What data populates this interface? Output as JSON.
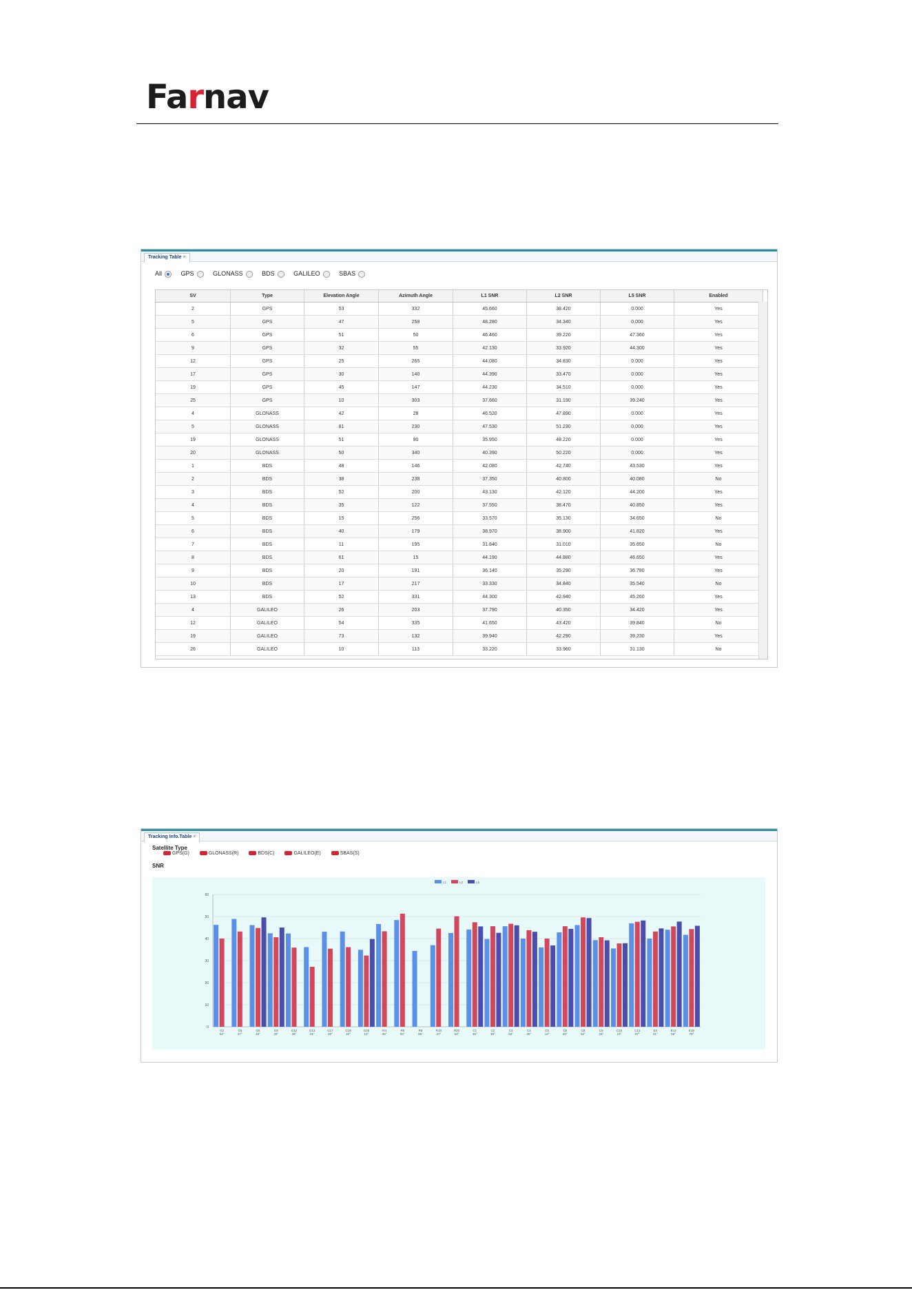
{
  "brand": "Farnav",
  "tracking_table": {
    "tab_label": "Tracking Table",
    "tab_close": "×",
    "filters": [
      {
        "label": "All",
        "checked": true
      },
      {
        "label": "GPS",
        "checked": false
      },
      {
        "label": "GLONASS",
        "checked": false
      },
      {
        "label": "BDS",
        "checked": false
      },
      {
        "label": "GALILEO",
        "checked": false
      },
      {
        "label": "SBAS",
        "checked": false
      }
    ],
    "columns": [
      "SV",
      "Type",
      "Elevation Angle",
      "Azimuth Angle",
      "L1 SNR",
      "L2 SNR",
      "L5 SNR",
      "Enabled"
    ],
    "rows": [
      [
        "2",
        "GPS",
        "53",
        "332",
        "45.660",
        "38.420",
        "0.000",
        "Yes"
      ],
      [
        "5",
        "GPS",
        "47",
        "258",
        "48.280",
        "34.340",
        "0.000",
        "Yes"
      ],
      [
        "6",
        "GPS",
        "51",
        "50",
        "46.460",
        "39.220",
        "47.360",
        "Yes"
      ],
      [
        "9",
        "GPS",
        "32",
        "55",
        "42.130",
        "33.920",
        "44.300",
        "Yes"
      ],
      [
        "12",
        "GPS",
        "25",
        "265",
        "44.080",
        "34.830",
        "0.000",
        "Yes"
      ],
      [
        "17",
        "GPS",
        "30",
        "140",
        "44.390",
        "33.470",
        "0.000",
        "Yes"
      ],
      [
        "19",
        "GPS",
        "45",
        "147",
        "44.230",
        "34.510",
        "0.000",
        "Yes"
      ],
      [
        "25",
        "GPS",
        "10",
        "303",
        "37.660",
        "31.190",
        "39.240",
        "Yes"
      ],
      [
        "4",
        "GLONASS",
        "42",
        "28",
        "46.520",
        "47.890",
        "0.000",
        "Yes"
      ],
      [
        "5",
        "GLONASS",
        "81",
        "230",
        "47.530",
        "51.230",
        "0.000",
        "Yes"
      ],
      [
        "19",
        "GLONASS",
        "51",
        "90",
        "35.950",
        "48.220",
        "0.000",
        "Yes"
      ],
      [
        "20",
        "GLONASS",
        "50",
        "340",
        "40.390",
        "50.220",
        "0.000",
        "Yes"
      ],
      [
        "1",
        "BDS",
        "48",
        "146",
        "42.080",
        "42.740",
        "43.530",
        "Yes"
      ],
      [
        "2",
        "BDS",
        "38",
        "238",
        "37.350",
        "40.800",
        "40.080",
        "No"
      ],
      [
        "3",
        "BDS",
        "52",
        "200",
        "43.130",
        "42.120",
        "44.200",
        "Yes"
      ],
      [
        "4",
        "BDS",
        "35",
        "122",
        "37.550",
        "38.470",
        "40.850",
        "Yes"
      ],
      [
        "5",
        "BDS",
        "15",
        "256",
        "33.570",
        "35.130",
        "34.650",
        "No"
      ],
      [
        "6",
        "BDS",
        "40",
        "179",
        "38.970",
        "38.900",
        "41.820",
        "Yes"
      ],
      [
        "7",
        "BDS",
        "11",
        "195",
        "31.840",
        "31.010",
        "35.650",
        "No"
      ],
      [
        "8",
        "BDS",
        "61",
        "15",
        "44.190",
        "44.880",
        "46.650",
        "Yes"
      ],
      [
        "9",
        "BDS",
        "20",
        "191",
        "36.140",
        "35.290",
        "36.780",
        "Yes"
      ],
      [
        "10",
        "BDS",
        "17",
        "217",
        "33.330",
        "34.840",
        "35.540",
        "No"
      ],
      [
        "13",
        "BDS",
        "52",
        "331",
        "44.300",
        "42.940",
        "45.260",
        "Yes"
      ],
      [
        "4",
        "GALILEO",
        "26",
        "203",
        "37.790",
        "40.350",
        "34.420",
        "Yes"
      ],
      [
        "12",
        "GALILEO",
        "54",
        "335",
        "41.650",
        "43.420",
        "39.840",
        "No"
      ],
      [
        "19",
        "GALILEO",
        "73",
        "132",
        "39.940",
        "42.290",
        "39.230",
        "Yes"
      ],
      [
        "26",
        "GALILEO",
        "10",
        "113",
        "33.220",
        "33.960",
        "31.130",
        "No"
      ]
    ]
  },
  "tracking_info": {
    "tab_label": "Tracking Info.Table",
    "tab_close": "×",
    "satellite_type_label": "Satellite Type",
    "legend": [
      "GPS(G)",
      "GLONASS(R)",
      "BDS(C)",
      "GALILEO(E)",
      "SBAS(S)"
    ],
    "legend_color": "#d7232f",
    "snr_label": "SNR"
  },
  "chart_data": {
    "type": "bar",
    "title": "",
    "xlabel": "",
    "ylabel": "",
    "ylim": [
      0,
      60
    ],
    "yticks": [
      "0",
      "10",
      "20",
      "30",
      "40",
      "50",
      "60"
    ],
    "grid": true,
    "legend_position": "top-center",
    "categories": [
      [
        "G2",
        "53°"
      ],
      [
        "G5",
        "37°"
      ],
      [
        "G6",
        "46°"
      ],
      [
        "G9",
        "29°"
      ],
      [
        "G12",
        "25°"
      ],
      [
        "G13",
        "31°"
      ],
      [
        "G17",
        "29°"
      ],
      [
        "G19",
        "40°"
      ],
      [
        "G25",
        "13°"
      ],
      [
        "R4",
        "36°"
      ],
      [
        "R5",
        "84°"
      ],
      [
        "R6",
        "86°"
      ],
      [
        "R19",
        "47°"
      ],
      [
        "R20",
        "53°"
      ],
      [
        "C1",
        "48°"
      ],
      [
        "C2",
        "38°"
      ],
      [
        "C3",
        "52°"
      ],
      [
        "C4",
        "35°"
      ],
      [
        "C5",
        "13°"
      ],
      [
        "C6",
        "40°"
      ],
      [
        "C8",
        "62°"
      ],
      [
        "C9",
        "22°"
      ],
      [
        "C10",
        "13°"
      ],
      [
        "C13",
        "57°"
      ],
      [
        "E4",
        "21°"
      ],
      [
        "E12",
        "58°"
      ],
      [
        "E19",
        "79°"
      ]
    ],
    "series": [
      {
        "name": "L1",
        "color": "#5b8fe8",
        "values": [
          46.2,
          48.9,
          46.1,
          42.4,
          42.3,
          36.1,
          43.1,
          43.2,
          34.9,
          46.6,
          48.4,
          34.4,
          37.0,
          42.5,
          44.1,
          39.8,
          45.6,
          40.0,
          36.0,
          42.8,
          46.1,
          39.3,
          35.5,
          46.9,
          40.0,
          44.0,
          41.7
        ]
      },
      {
        "name": "L2",
        "color": "#d2475c",
        "values": [
          40.0,
          43.2,
          44.8,
          40.6,
          35.9,
          27.2,
          35.4,
          36.1,
          32.3,
          43.3,
          51.3,
          0,
          44.5,
          50.1,
          47.4,
          45.6,
          46.7,
          43.8,
          40.0,
          45.6,
          49.6,
          40.6,
          37.8,
          47.6,
          43.2,
          45.5,
          44.3
        ]
      },
      {
        "name": "L5",
        "color": "#4a4dab",
        "values": [
          0,
          0,
          49.6,
          45.0,
          0,
          0,
          0,
          0,
          39.8,
          0,
          0,
          0,
          0,
          0,
          45.5,
          42.6,
          46.0,
          43.1,
          36.9,
          44.4,
          49.3,
          39.2,
          37.9,
          48.2,
          44.6,
          47.7,
          45.8
        ]
      }
    ]
  }
}
